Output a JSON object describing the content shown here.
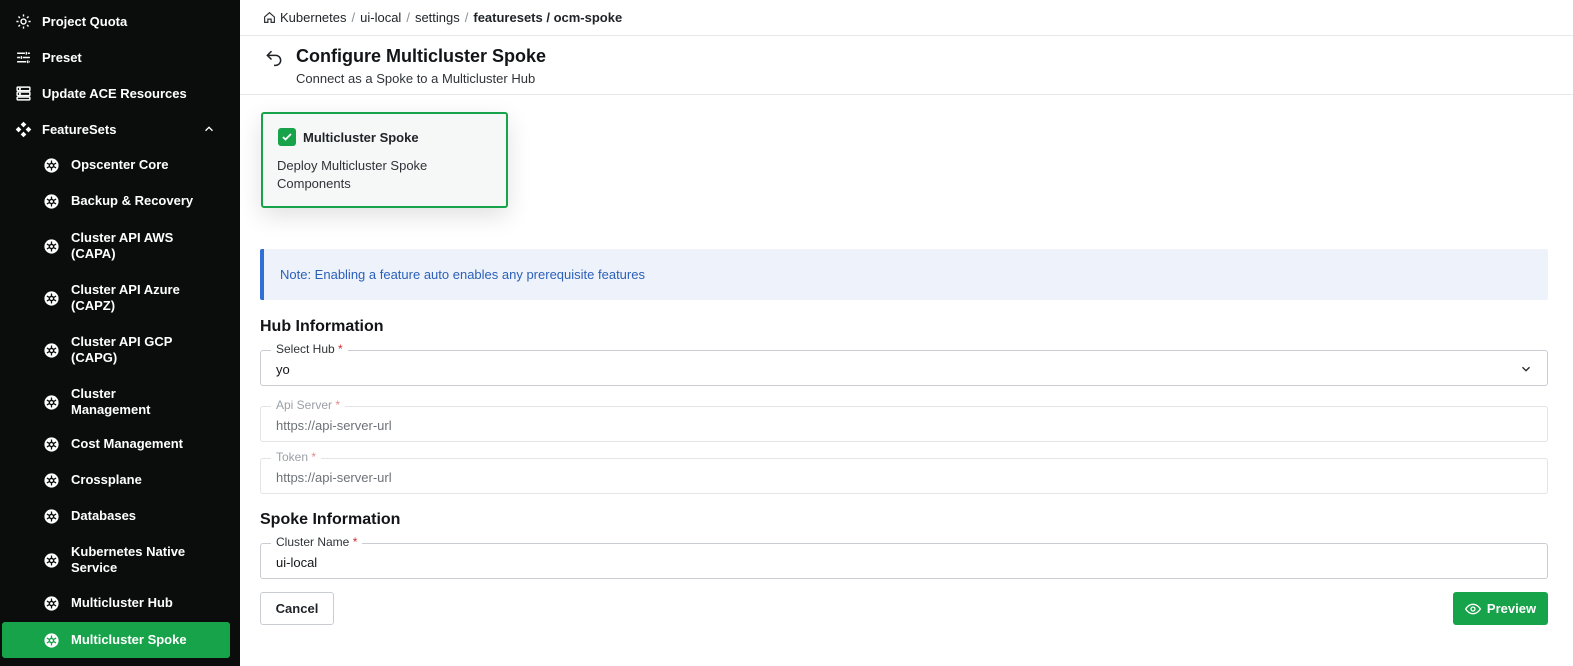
{
  "sidebar": {
    "top_items": [
      {
        "label": "Project Quota",
        "icon": "gear-icon"
      },
      {
        "label": "Preset",
        "icon": "sliders-icon"
      },
      {
        "label": "Update ACE Resources",
        "icon": "server-icon"
      },
      {
        "label": "FeatureSets",
        "icon": "featuresets-icon"
      }
    ],
    "sub_items": [
      {
        "label": "Opscenter Core"
      },
      {
        "label": "Backup & Recovery"
      },
      {
        "label": "Cluster API AWS (CAPA)"
      },
      {
        "label": "Cluster API Azure (CAPZ)"
      },
      {
        "label": "Cluster API GCP (CAPG)"
      },
      {
        "label": "Cluster Management"
      },
      {
        "label": "Cost Management"
      },
      {
        "label": "Crossplane"
      },
      {
        "label": "Databases"
      },
      {
        "label": "Kubernetes Native Service"
      },
      {
        "label": "Multicluster Hub"
      },
      {
        "label": "Multicluster Spoke",
        "active": true
      }
    ]
  },
  "breadcrumb": {
    "items": [
      "Kubernetes",
      "ui-local",
      "settings"
    ],
    "current": "featuresets / ocm-spoke"
  },
  "header": {
    "title": "Configure Multicluster Spoke",
    "subtitle": "Connect as a Spoke to a Multicluster Hub"
  },
  "feature_card": {
    "name": "Multicluster Spoke",
    "description": "Deploy Multicluster Spoke Components",
    "checked": true
  },
  "note": "Note: Enabling a feature auto enables any prerequisite features",
  "hub_section": {
    "title": "Hub Information",
    "select_hub": {
      "label": "Select Hub",
      "required": "*",
      "value": "yo"
    },
    "api_server": {
      "label": "Api Server",
      "required": "*",
      "placeholder": "https://api-server-url"
    },
    "token": {
      "label": "Token",
      "required": "*",
      "placeholder": "https://api-server-url"
    }
  },
  "spoke_section": {
    "title": "Spoke Information",
    "cluster_name": {
      "label": "Cluster Name",
      "required": "*",
      "value": "ui-local"
    }
  },
  "actions": {
    "cancel_label": "Cancel",
    "preview_label": "Preview"
  },
  "colors": {
    "sidebar_bg": "#0b0d0c",
    "accent_green": "#17a34a",
    "note_bg": "#eef3fb",
    "note_border": "#2f6fd6",
    "required": "#d12c2c"
  }
}
